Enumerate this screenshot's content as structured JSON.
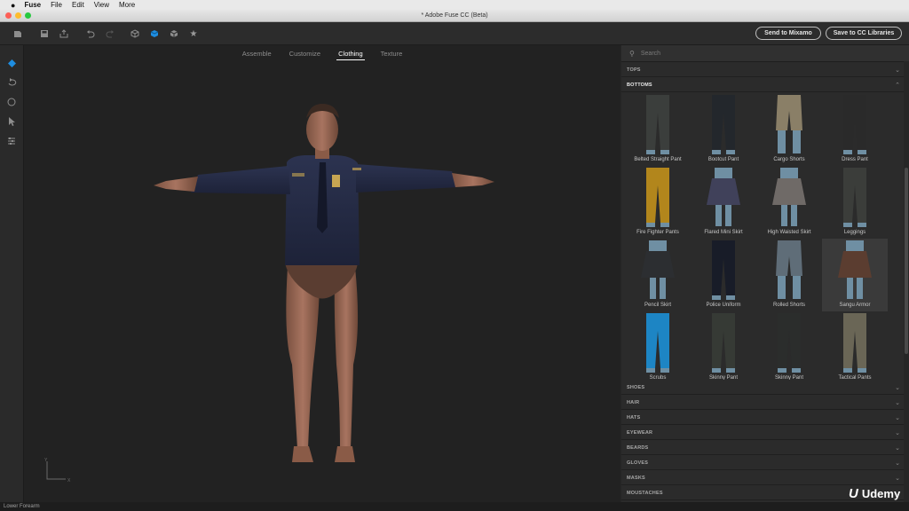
{
  "menubar": {
    "apple": "",
    "app": "Fuse",
    "items": [
      "File",
      "Edit",
      "View",
      "More"
    ]
  },
  "window": {
    "title": "* Adobe Fuse CC (Beta)"
  },
  "toolbar": {
    "icons": [
      "import-icon",
      "save-icon",
      "export-icon",
      "undo-icon",
      "redo-icon",
      "wireframe-cube-icon",
      "shaded-cube-icon",
      "textured-cube-icon",
      "favorite-star-icon"
    ],
    "send_label": "Send to Mixamo",
    "save_label": "Save to CC Libraries"
  },
  "tabs": [
    {
      "label": "Assemble",
      "active": false
    },
    {
      "label": "Customize",
      "active": false
    },
    {
      "label": "Clothing",
      "active": true
    },
    {
      "label": "Texture",
      "active": false
    }
  ],
  "left_tools": [
    "select-tool-icon",
    "rotate-icon",
    "orbit-icon",
    "pointer-icon",
    "settings-sliders-icon"
  ],
  "axis": {
    "y": "Y",
    "x": "X"
  },
  "panel": {
    "search_placeholder": "Search",
    "categories_top": [
      {
        "label": "TOPS"
      },
      {
        "label": "BOTTOMS",
        "expanded": true
      }
    ],
    "items": [
      {
        "label": "Belted Straight Pant",
        "color": "#3b3e3c"
      },
      {
        "label": "Bootcut Pant",
        "color": "#23272c"
      },
      {
        "label": "Cargo Shorts",
        "color": "#8a7f67"
      },
      {
        "label": "Dress Pant",
        "color": "#2a2a2a"
      },
      {
        "label": "Fire Fighter Pants",
        "color": "#b2861c"
      },
      {
        "label": "Flared Mini Skirt",
        "color": "#40415a"
      },
      {
        "label": "High Waisted Skirt",
        "color": "#6f6a67"
      },
      {
        "label": "Leggings",
        "color": "#3b3d3a"
      },
      {
        "label": "Pencil Skirt",
        "color": "#2c2e31"
      },
      {
        "label": "Police Uniform",
        "color": "#181c28"
      },
      {
        "label": "Rolled Shorts",
        "color": "#5f6d78"
      },
      {
        "label": "Sangu Armor",
        "color": "#5b3d30"
      },
      {
        "label": "Scrubs",
        "color": "#1d85c4"
      },
      {
        "label": "Skinny Pant",
        "color": "#363a35"
      },
      {
        "label": "Skinny Pant",
        "color": "#2b2d2c"
      },
      {
        "label": "Tactical Pants",
        "color": "#6a6656"
      }
    ],
    "selected_item": "Sangu Armor",
    "categories_bottom": [
      {
        "label": "SHOES"
      },
      {
        "label": "HAIR"
      },
      {
        "label": "HATS"
      },
      {
        "label": "EYEWEAR"
      },
      {
        "label": "BEARDS"
      },
      {
        "label": "GLOVES"
      },
      {
        "label": "MASKS"
      },
      {
        "label": "MOUSTACHES"
      }
    ]
  },
  "status": {
    "text": "Lower Forearm"
  },
  "watermark": {
    "text": "Udemy"
  }
}
